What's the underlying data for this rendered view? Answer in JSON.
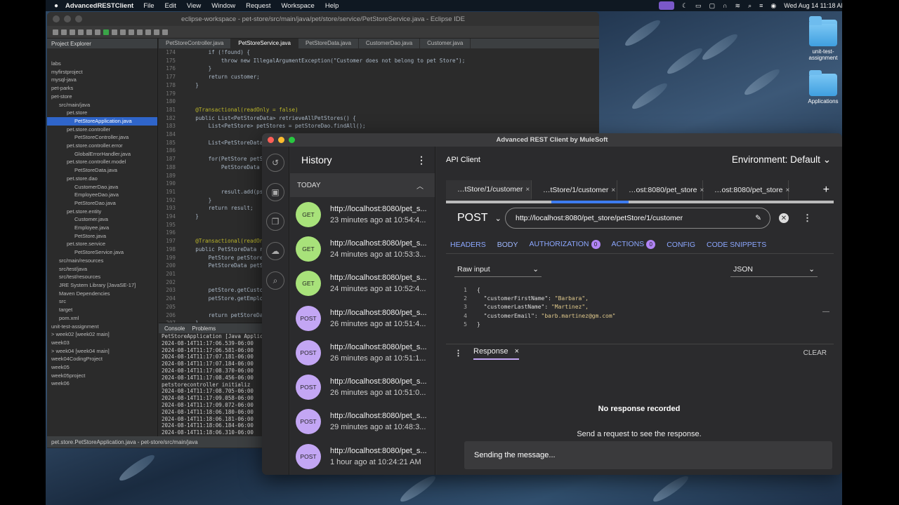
{
  "menubar": {
    "app": "AdvancedRESTClient",
    "items": [
      "File",
      "Edit",
      "View",
      "Window",
      "Request",
      "Workspace",
      "Help"
    ],
    "clock": "Wed Aug 14  11:18 AM"
  },
  "desktop": {
    "icons": [
      {
        "label": ""
      },
      {
        "label": "unit-test-assignment"
      },
      {
        "label": "Applications"
      }
    ]
  },
  "eclipse": {
    "title": "eclipse-workspace - pet-store/src/main/java/pet/store/service/PetStoreService.java - Eclipse IDE",
    "project_explorer_title": "Project Explorer",
    "tree": [
      "labs",
      "myfirstproject",
      "mysql-java",
      "pet-parks",
      "pet-store",
      "src/main/java",
      "pet.store",
      "PetStoreApplication.java",
      "pet.store.controller",
      "PetStoreController.java",
      "pet.store.controller.error",
      "GlobalErrorHandler.java",
      "pet.store.controller.model",
      "PetStoreData.java",
      "pet.store.dao",
      "CustomerDao.java",
      "EmployeeDao.java",
      "PetStoreDao.java",
      "pet.store.entity",
      "Customer.java",
      "Employee.java",
      "PetStore.java",
      "pet.store.service",
      "PetStoreService.java",
      "src/main/resources",
      "src/test/java",
      "src/test/resources",
      "JRE System Library [JavaSE-17]",
      "Maven Dependencies",
      "src",
      "target",
      "pom.xml",
      "unit-test-assignment",
      "> week02 [week02 main]",
      "week03",
      "> week04 [week04 main]",
      "week04CodingProject",
      "week05",
      "week05project",
      "week06"
    ],
    "tabs": [
      "PetStoreController.java",
      "PetStoreService.java",
      "PetStoreData.java",
      "CustomerDao.java",
      "Customer.java"
    ],
    "code": [
      {
        "n": "174",
        "t": "        if (!found) {"
      },
      {
        "n": "175",
        "t": "            throw new IllegalArgumentException(\"Customer does not belong to pet Store\");"
      },
      {
        "n": "176",
        "t": "        }"
      },
      {
        "n": "177",
        "t": "        return customer;"
      },
      {
        "n": "178",
        "t": "    }"
      },
      {
        "n": "179",
        "t": ""
      },
      {
        "n": "180",
        "t": ""
      },
      {
        "n": "181",
        "t": "    @Transactional(readOnly = false)"
      },
      {
        "n": "182",
        "t": "    public List<PetStoreData> retrieveAllPetStores() {"
      },
      {
        "n": "183",
        "t": "        List<PetStore> petStores = petStoreDao.findAll();"
      },
      {
        "n": "184",
        "t": ""
      },
      {
        "n": "185",
        "t": "        List<PetStoreData>"
      },
      {
        "n": "186",
        "t": ""
      },
      {
        "n": "187",
        "t": "        for(PetStore petSto"
      },
      {
        "n": "188",
        "t": "            PetStoreData ps"
      },
      {
        "n": "189",
        "t": ""
      },
      {
        "n": "190",
        "t": ""
      },
      {
        "n": "191",
        "t": "            result.add(psd)"
      },
      {
        "n": "192",
        "t": "        }"
      },
      {
        "n": "193",
        "t": "        return result;"
      },
      {
        "n": "194",
        "t": "    }"
      },
      {
        "n": "195",
        "t": ""
      },
      {
        "n": "196",
        "t": ""
      },
      {
        "n": "197",
        "t": "    @Transactional(readOnly"
      },
      {
        "n": "198",
        "t": "    public PetStoreData retr"
      },
      {
        "n": "199",
        "t": "        PetStore petStore ="
      },
      {
        "n": "200",
        "t": "        PetStoreData petSto"
      },
      {
        "n": "201",
        "t": ""
      },
      {
        "n": "202",
        "t": ""
      },
      {
        "n": "203",
        "t": "        petStore.getCustome"
      },
      {
        "n": "204",
        "t": "        petStore.getEmploye"
      },
      {
        "n": "205",
        "t": ""
      },
      {
        "n": "206",
        "t": "        return petStoreData"
      },
      {
        "n": "207",
        "t": "    }"
      },
      {
        "n": "208",
        "t": ""
      },
      {
        "n": "209",
        "t": "    @Transactional"
      },
      {
        "n": "210",
        "t": "    public void deletePetSt"
      },
      {
        "n": "211",
        "t": "        PetStore petStore ="
      }
    ],
    "console_tab": "Console",
    "problems_tab": "Problems",
    "console_lines": [
      "PetStoreApplication [Java Application] /",
      "2024-08-14T11:17:06.539-06:00",
      "2024-08-14T11:17:06.581-06:00",
      "2024-08-14T11:17:07.181-06:00",
      "2024-08-14T11:17:07.184-06:00",
      "2024-08-14T11:17:08.370-06:00",
      "2024-08-14T11:17:08.456-06:00",
      "petstorecontroller initializ",
      "2024-08-14T11:17:08.705-06:00",
      "2024-08-14T11:17:09.058-06:00",
      "2024-08-14T11:17:09.072-06:00",
      "2024-08-14T11:18:06.180-06:00",
      "2024-08-14T11:18:06.181-06:00",
      "2024-08-14T11:18:06.184-06:00",
      "2024-08-14T11:18:06.310-06:00"
    ],
    "status": "pet.store.PetStoreApplication.java - pet-store/src/main/java"
  },
  "arc": {
    "title": "Advanced REST Client by MuleSoft",
    "history_title": "History",
    "today_label": "TODAY",
    "history": [
      {
        "method": "GET",
        "url": "http://localhost:8080/pet_s...",
        "time": "23 minutes ago at 10:54:4..."
      },
      {
        "method": "GET",
        "url": "http://localhost:8080/pet_s...",
        "time": "24 minutes ago at 10:53:3..."
      },
      {
        "method": "GET",
        "url": "http://localhost:8080/pet_s...",
        "time": "24 minutes ago at 10:52:4..."
      },
      {
        "method": "POST",
        "url": "http://localhost:8080/pet_s...",
        "time": "26 minutes ago at 10:51:4..."
      },
      {
        "method": "POST",
        "url": "http://localhost:8080/pet_s...",
        "time": "26 minutes ago at 10:51:1..."
      },
      {
        "method": "POST",
        "url": "http://localhost:8080/pet_s...",
        "time": "26 minutes ago at 10:51:0..."
      },
      {
        "method": "POST",
        "url": "http://localhost:8080/pet_s...",
        "time": "29 minutes ago at 10:48:3..."
      },
      {
        "method": "POST",
        "url": "http://localhost:8080/pet_s...",
        "time": "1 hour ago at 10:24:21 AM"
      }
    ],
    "api_client_label": "API Client",
    "environment": "Environment: Default",
    "request_tabs": [
      "…tStore/1/customer",
      "…tStore/1/customer",
      "…ost:8080/pet_store",
      "…ost:8080/pet_store"
    ],
    "method": "POST",
    "url": "http://localhost:8080/pet_store/petStore/1/customer",
    "req_tabs": {
      "headers": "HEADERS",
      "body": "BODY",
      "authorization": "AUTHORIZATION",
      "authorization_count": "0",
      "actions": "ACTIONS",
      "actions_count": "0",
      "config": "CONFIG",
      "code_snippets": "CODE SNIPPETS"
    },
    "body_editor": "Raw input",
    "content_type": "JSON",
    "json_lines": [
      {
        "n": "1",
        "t": "{"
      },
      {
        "n": "2",
        "k": "\"customerFirstName\"",
        "v": "\"Barbara\","
      },
      {
        "n": "3",
        "k": "\"customerLastName\"",
        "v": "\"Martinez\","
      },
      {
        "n": "4",
        "k": "\"customerEmail\"",
        "v": "\"barb.martinez@gm.com\""
      },
      {
        "n": "5",
        "t": "}"
      }
    ],
    "response_tab": "Response",
    "clear_label": "CLEAR",
    "no_response": "No response recorded",
    "send_hint": "Send a request to see the response.",
    "toast": "Sending the message...",
    "progress_fraction": 0.2
  },
  "colors": {
    "get": "#a8e27a",
    "post": "#c3a6f4",
    "accent": "#3d7cf0",
    "tab_link": "#8ca7ff"
  }
}
